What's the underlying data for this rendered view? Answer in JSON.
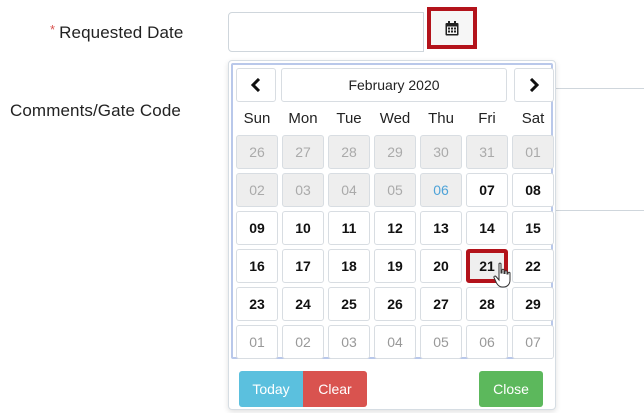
{
  "form": {
    "required_marker": "*",
    "requested_date_label": "Requested Date",
    "comments_label": "Comments/Gate Code",
    "date_input_value": "",
    "calendar_button_icon": "calendar-icon"
  },
  "datepicker": {
    "prev_icon": "chevron-left-icon",
    "next_icon": "chevron-right-icon",
    "month_title": "February 2020",
    "weekdays": [
      "Sun",
      "Mon",
      "Tue",
      "Wed",
      "Thu",
      "Fri",
      "Sat"
    ],
    "weeks": [
      [
        "26",
        "27",
        "28",
        "29",
        "30",
        "31",
        "01"
      ],
      [
        "02",
        "03",
        "04",
        "05",
        "06",
        "07",
        "08"
      ],
      [
        "09",
        "10",
        "11",
        "12",
        "13",
        "14",
        "15"
      ],
      [
        "16",
        "17",
        "18",
        "19",
        "20",
        "21",
        "22"
      ],
      [
        "23",
        "24",
        "25",
        "26",
        "27",
        "28",
        "29"
      ],
      [
        "01",
        "02",
        "03",
        "04",
        "05",
        "06",
        "07"
      ]
    ],
    "today_label": "Today",
    "clear_label": "Clear",
    "close_label": "Close",
    "today_date": "06",
    "selected_date": "21"
  },
  "colors": {
    "highlight_border": "#b3131b",
    "today_button": "#5bc0de",
    "clear_button": "#d9534f",
    "close_button": "#5cb85c",
    "today_text": "#4ea3d8"
  }
}
